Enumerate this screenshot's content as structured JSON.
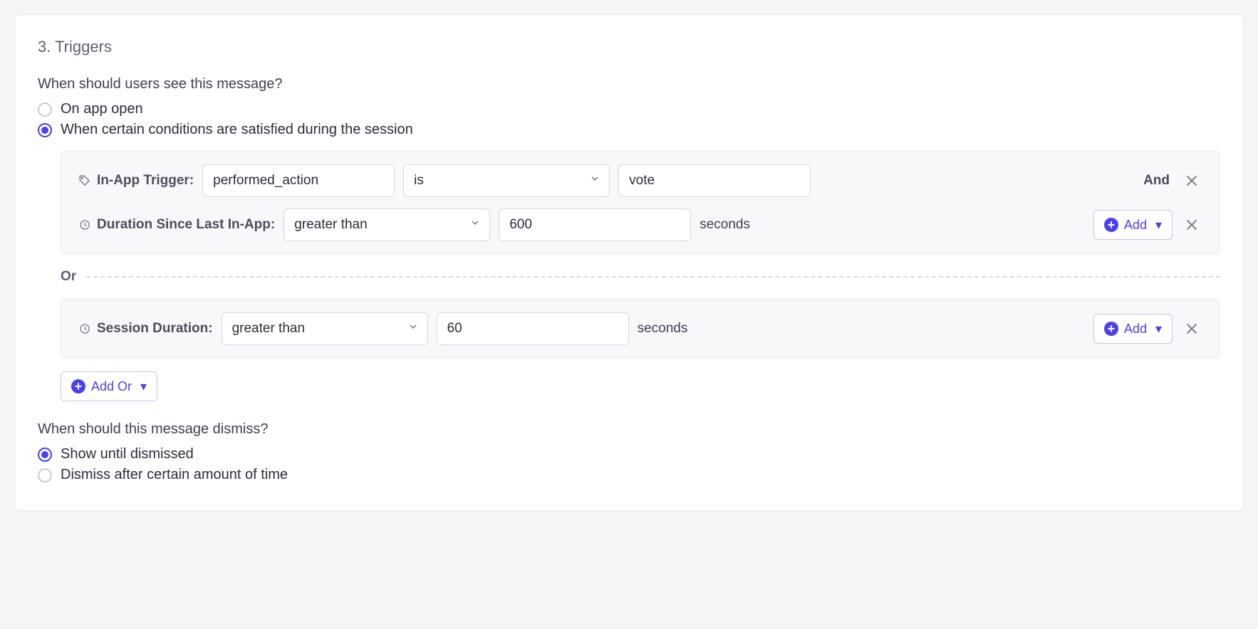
{
  "section_title": "3. Triggers",
  "when_see_question": "When should users see this message?",
  "radios_see": {
    "on_open": "On app open",
    "conditions": "When certain conditions are satisfied during the session"
  },
  "group1": {
    "trigger_label": "In-App Trigger:",
    "trigger_key": "performed_action",
    "trigger_op": "is",
    "trigger_value": "vote",
    "joiner": "And",
    "duration_label": "Duration Since Last In-App:",
    "duration_op": "greater than",
    "duration_value": "600",
    "duration_unit": "seconds",
    "add_label": "Add"
  },
  "or_label": "Or",
  "group2": {
    "session_label": "Session Duration:",
    "session_op": "greater than",
    "session_value": "60",
    "session_unit": "seconds",
    "add_label": "Add"
  },
  "add_or_label": "Add Or",
  "when_dismiss_question": "When should this message dismiss?",
  "radios_dismiss": {
    "until": "Show until dismissed",
    "after": "Dismiss after certain amount of time"
  }
}
